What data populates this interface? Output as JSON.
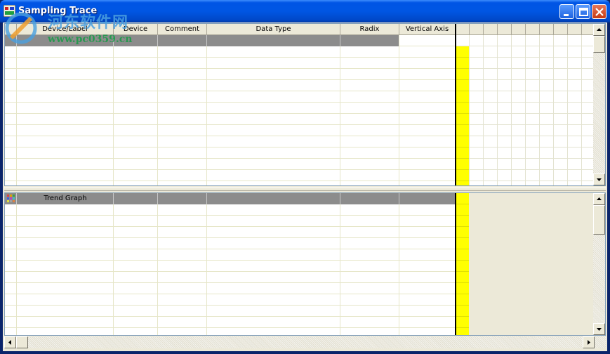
{
  "window": {
    "title": "Sampling Trace"
  },
  "watermark": {
    "cn": "河东软件网",
    "url": "www.pc0359.cn"
  },
  "columns": [
    {
      "key": "device_label",
      "label": "Device/Label"
    },
    {
      "key": "device",
      "label": "Device"
    },
    {
      "key": "comment",
      "label": "Comment"
    },
    {
      "key": "data_type",
      "label": "Data Type"
    },
    {
      "key": "radix",
      "label": "Radix"
    },
    {
      "key": "vertical_axis",
      "label": "Vertical Axis"
    }
  ],
  "trend_pane": {
    "row_label": "Trend Graph"
  },
  "icons": {
    "app": "sampling-trace-app-icon",
    "minimize": "minimize-icon",
    "maximize": "maximize-icon",
    "close": "close-icon",
    "trend_row": "grid-icon"
  },
  "colors": {
    "title_bar": "#0055e5",
    "selected_row": "#8c8c8c",
    "cursor_band": "#ffff00",
    "grid_line": "#e6e6c8"
  }
}
